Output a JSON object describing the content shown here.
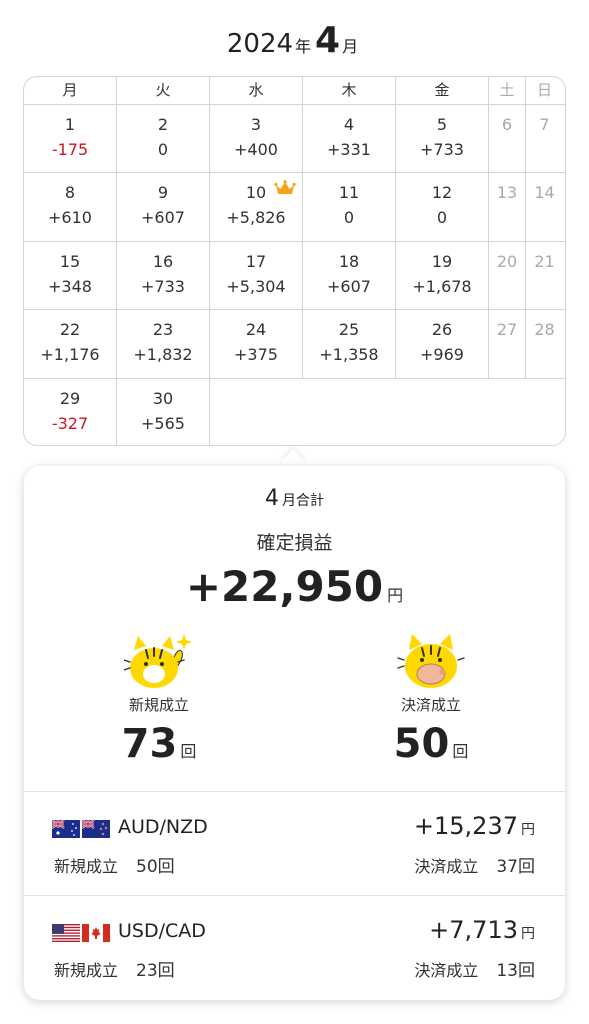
{
  "header": {
    "year": "2024",
    "year_unit": "年",
    "month": "4",
    "month_unit": "月"
  },
  "calendar": {
    "weekdays": [
      "月",
      "火",
      "水",
      "木",
      "金",
      "土",
      "日"
    ],
    "weeks": [
      [
        {
          "day": "1",
          "value": "-175",
          "neg": true
        },
        {
          "day": "2",
          "value": "0"
        },
        {
          "day": "3",
          "value": "+400"
        },
        {
          "day": "4",
          "value": "+331"
        },
        {
          "day": "5",
          "value": "+733"
        },
        {
          "day": "6"
        },
        {
          "day": "7"
        }
      ],
      [
        {
          "day": "8",
          "value": "+610"
        },
        {
          "day": "9",
          "value": "+607"
        },
        {
          "day": "10",
          "value": "+5,826",
          "crown": true
        },
        {
          "day": "11",
          "value": "0"
        },
        {
          "day": "12",
          "value": "0"
        },
        {
          "day": "13"
        },
        {
          "day": "14"
        }
      ],
      [
        {
          "day": "15",
          "value": "+348"
        },
        {
          "day": "16",
          "value": "+733"
        },
        {
          "day": "17",
          "value": "+5,304"
        },
        {
          "day": "18",
          "value": "+607"
        },
        {
          "day": "19",
          "value": "+1,678"
        },
        {
          "day": "20"
        },
        {
          "day": "21"
        }
      ],
      [
        {
          "day": "22",
          "value": "+1,176"
        },
        {
          "day": "23",
          "value": "+1,832"
        },
        {
          "day": "24",
          "value": "+375"
        },
        {
          "day": "25",
          "value": "+1,358"
        },
        {
          "day": "26",
          "value": "+969"
        },
        {
          "day": "27"
        },
        {
          "day": "28"
        }
      ],
      [
        {
          "day": "29",
          "value": "-327",
          "neg": true
        },
        {
          "day": "30",
          "value": "+565"
        }
      ]
    ]
  },
  "summary": {
    "month": "4",
    "month_total_label": "月合計",
    "confirmed_label": "確定損益",
    "total": "+22,950",
    "yen": "円",
    "new_label": "新規成立",
    "new_count": "73",
    "close_label": "決済成立",
    "close_count": "50",
    "count_unit": "回"
  },
  "pairs": [
    {
      "name": "AUD/NZD",
      "amount": "+15,237",
      "yen": "円",
      "new_label": "新規成立",
      "new_count": "50回",
      "close_label": "決済成立",
      "close_count": "37回",
      "flags": [
        "australia-flag-icon",
        "new-zealand-flag-icon"
      ]
    },
    {
      "name": "USD/CAD",
      "amount": "+7,713",
      "yen": "円",
      "new_label": "新規成立",
      "new_count": "23回",
      "close_label": "決済成立",
      "close_count": "13回",
      "flags": [
        "usa-flag-icon",
        "canada-flag-icon"
      ]
    }
  ],
  "colors": {
    "negative": "#d0151f",
    "weekend": "#aaaaaa",
    "crown": "#f5a31a",
    "mascot": "#ffd800"
  }
}
